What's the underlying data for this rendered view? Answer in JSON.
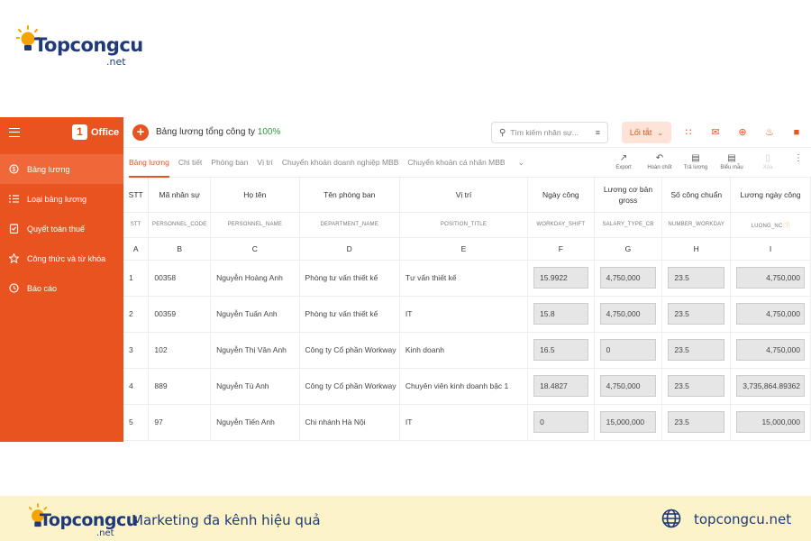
{
  "logo": {
    "brand": "Topcongcu",
    "net": ".net"
  },
  "sidebar": {
    "office_number": "1",
    "office_label": "Office",
    "items": [
      {
        "label": "Bảng lương",
        "icon": "money-circle-icon",
        "active": true
      },
      {
        "label": "Loại bảng lương",
        "icon": "list-icon",
        "active": false
      },
      {
        "label": "Quyết toán thuế",
        "icon": "document-check-icon",
        "active": false
      },
      {
        "label": "Công thức và từ khóa",
        "icon": "star-icon",
        "active": false
      },
      {
        "label": "Báo cáo",
        "icon": "clock-icon",
        "active": false
      }
    ]
  },
  "header": {
    "title": "Bảng lương tổng công ty",
    "percent": "100%",
    "search_placeholder": "Tìm kiếm nhân sự...",
    "shortcut_label": "Lối tắt",
    "accent": "#e9531f"
  },
  "tabs": [
    "Bảng lương",
    "Chi tiết",
    "Phòng ban",
    "Vị trí",
    "Chuyển khoản doanh nghiệp MBB",
    "Chuyển khoản cá nhân MBB"
  ],
  "actions": [
    "Export",
    "Hoàn chốt",
    "Trả lương",
    "Biểu mẫu",
    "Xóa"
  ],
  "table": {
    "headers": [
      "STT",
      "Mã nhân sự",
      "Họ tên",
      "Tên phòng ban",
      "Vị trí",
      "Ngày công",
      "Lương cơ bản gross",
      "Số công chuẩn",
      "Lương ngày công"
    ],
    "codes": [
      "STT",
      "PERSONNEL_CODE",
      "PERSONNEL_NAME",
      "DEPARTMENT_NAME",
      "POSITION_TITLE",
      "WORKDAY_SHIFT",
      "SALARY_TYPE_CB",
      "NUMBER_WORKDAY",
      "LUONG_NC"
    ],
    "letters": [
      "A",
      "B",
      "C",
      "D",
      "E",
      "F",
      "G",
      "H",
      "I"
    ],
    "rows": [
      [
        "1",
        "00358",
        "Nguyễn Hoàng Anh",
        "Phòng tư vấn thiết kế",
        "Tư vấn thiết kế",
        "15.9922",
        "4,750,000",
        "23.5",
        "4,750,000"
      ],
      [
        "2",
        "00359",
        "Nguyễn Tuấn Anh",
        "Phòng tư vấn thiết kế",
        "IT",
        "15.8",
        "4,750,000",
        "23.5",
        "4,750,000"
      ],
      [
        "3",
        "102",
        "Nguyễn Thị Vân Anh",
        "Công ty Cổ phần Workway",
        "Kinh doanh",
        "16.5",
        "0",
        "23.5",
        "4,750,000"
      ],
      [
        "4",
        "889",
        "Nguyễn Tú Anh",
        "Công ty Cổ phần Workway",
        "Chuyên viên kinh doanh bậc 1",
        "18.4827",
        "4,750,000",
        "23.5",
        "3,735,864.89362"
      ],
      [
        "5",
        "97",
        "Nguyễn Tiến Anh",
        "Chi nhánh Hà Nội",
        "IT",
        "0",
        "15,000,000",
        "23.5",
        "15,000,000"
      ]
    ]
  },
  "footer": {
    "brand": "Topcongcu",
    "net": ".net",
    "tagline": "Marketing đa kênh hiệu quả",
    "website": "topcongcu.net",
    "bg_color": "#fdf3c8"
  }
}
